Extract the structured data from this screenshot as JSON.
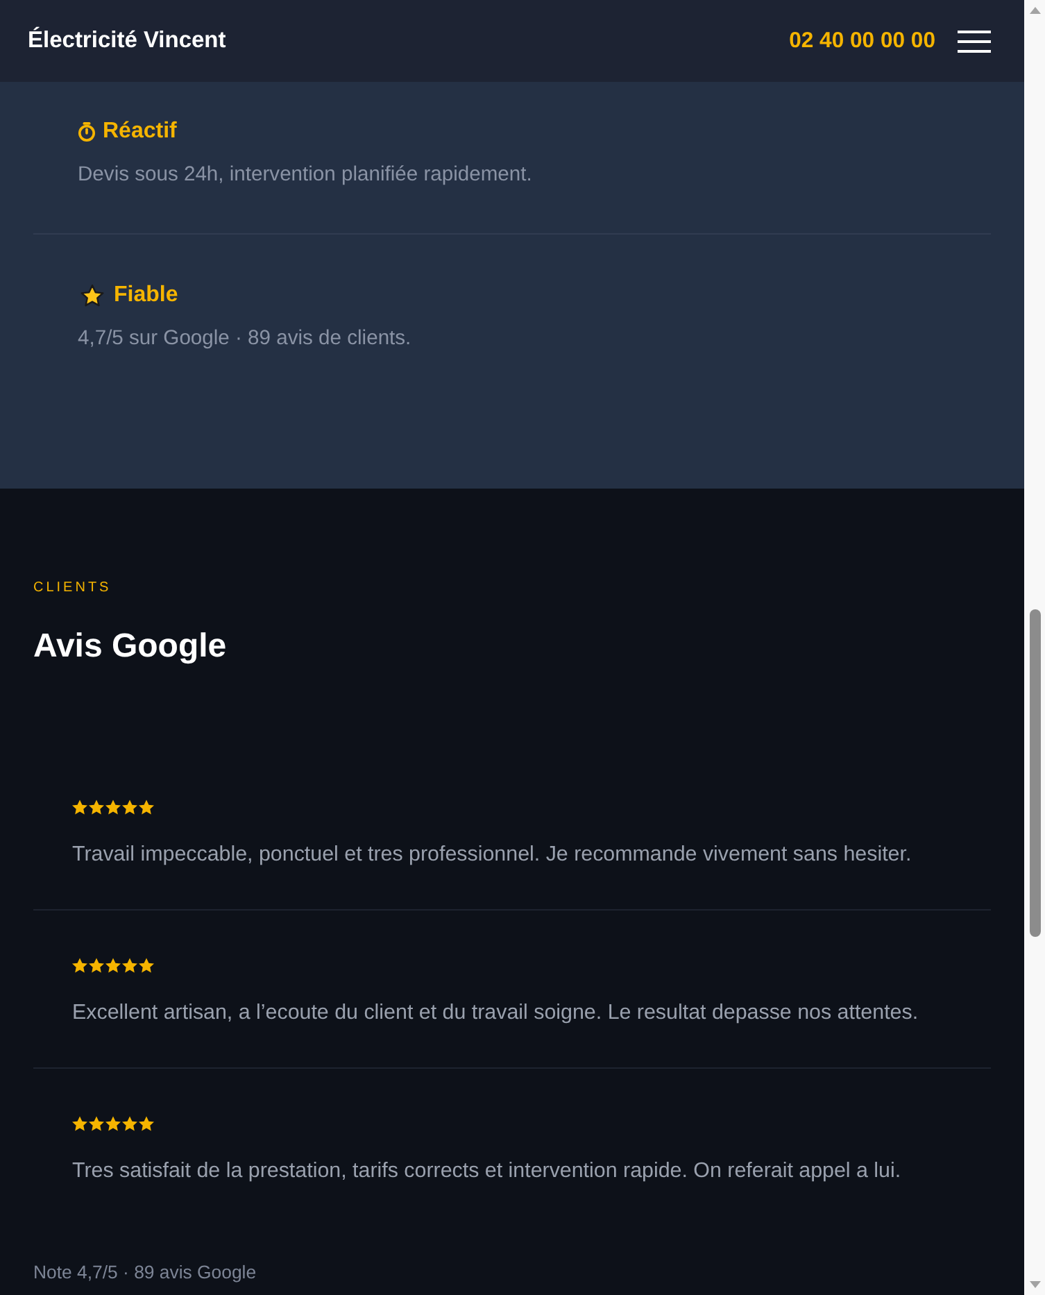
{
  "header": {
    "brand": "Électricité Vincent",
    "phone": "02 40 00 00 00"
  },
  "features": [
    {
      "kind": "stopwatch",
      "title": "Réactif",
      "text": "Devis sous 24h, intervention planifiée rapidement."
    },
    {
      "kind": "star",
      "title": "Fiable",
      "text": "4,7/5 sur Google · 89 avis de clients."
    }
  ],
  "reviews_section": {
    "eyebrow": "CLIENTS",
    "title": "Avis Google",
    "reviews": [
      {
        "stars": 5,
        "text": "Travail impeccable, ponctuel et tres professionnel. Je recommande vivement sans hesiter."
      },
      {
        "stars": 5,
        "text": "Excellent artisan, a l’ecoute du client et du travail soigne. Le resultat depasse nos attentes."
      },
      {
        "stars": 5,
        "text": "Tres satisfait de la prestation, tarifs corrects et intervention rapide. On referait appel a lui."
      }
    ],
    "summary": "Note 4,7/5 · 89 avis Google"
  }
}
